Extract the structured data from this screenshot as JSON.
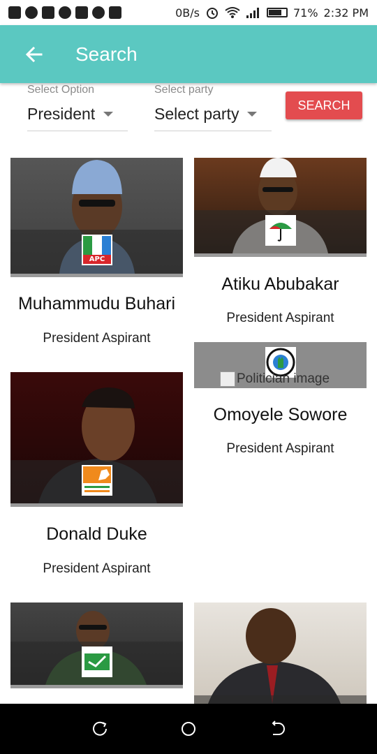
{
  "status_bar": {
    "net_speed": "0B/s",
    "battery": "71%",
    "time": "2:32 PM"
  },
  "app_bar": {
    "title": "Search"
  },
  "filters": {
    "option": {
      "label": "Select Option",
      "value": "President"
    },
    "party": {
      "label": "Select party",
      "value": "Select party"
    },
    "search_label": "SEARCH"
  },
  "candidates": [
    {
      "name": "Muhammudu Buhari",
      "role": "President Aspirant",
      "party_logo_text": "APC"
    },
    {
      "name": "Atiku Abubakar",
      "role": "President Aspirant"
    },
    {
      "name": "Omoyele Sowore",
      "role": "President Aspirant",
      "broken_image_alt": "Politician image"
    },
    {
      "name": "Donald Duke",
      "role": "President Aspirant"
    }
  ]
}
